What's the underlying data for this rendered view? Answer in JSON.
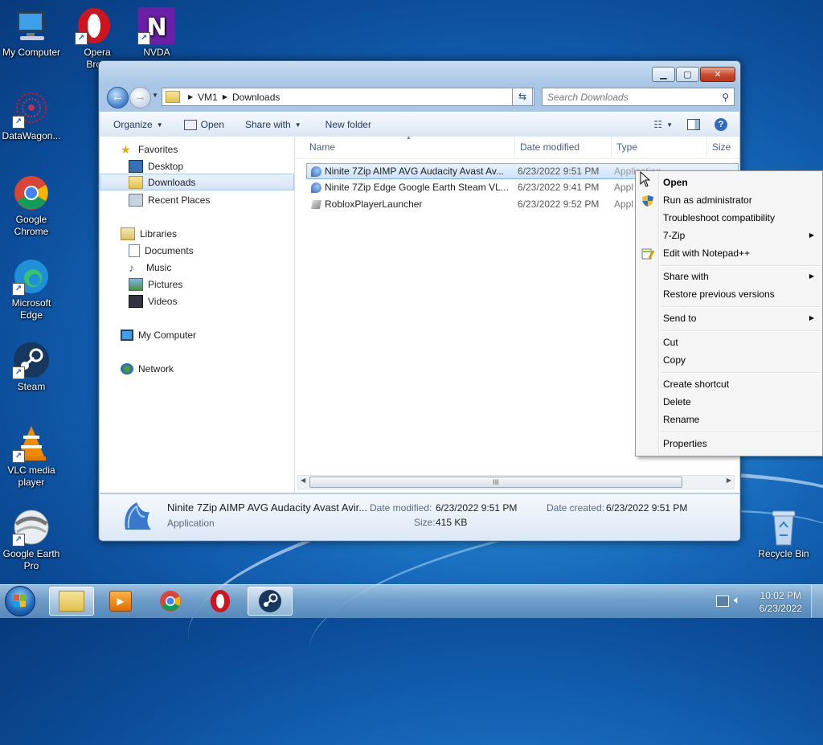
{
  "desktop": {
    "icons": [
      {
        "label": "My Computer"
      },
      {
        "label": "Opera Brow"
      },
      {
        "label": "NVDA"
      },
      {
        "label": "DataWagon..."
      },
      {
        "label": "Google Chrome"
      },
      {
        "label": "Microsoft Edge"
      },
      {
        "label": "Steam"
      },
      {
        "label": "VLC media player"
      },
      {
        "label": "Google Earth Pro"
      },
      {
        "label": "Recycle Bin"
      }
    ]
  },
  "explorer": {
    "breadcrumb": [
      "VM1",
      "Downloads"
    ],
    "search_placeholder": "Search Downloads",
    "toolbar": {
      "organize": "Organize",
      "open": "Open",
      "share_with": "Share with",
      "new_folder": "New folder"
    },
    "nav": {
      "favorites": "Favorites",
      "desktop": "Desktop",
      "downloads": "Downloads",
      "recent_places": "Recent Places",
      "libraries": "Libraries",
      "documents": "Documents",
      "music": "Music",
      "pictures": "Pictures",
      "videos": "Videos",
      "my_computer": "My Computer",
      "network": "Network"
    },
    "columns": {
      "name": "Name",
      "date_modified": "Date modified",
      "type": "Type",
      "size": "Size"
    },
    "files": [
      {
        "name": "Ninite 7Zip AIMP AVG Audacity Avast Av...",
        "date": "6/23/2022 9:51 PM",
        "type": "Application"
      },
      {
        "name": "Ninite 7Zip Edge Google Earth Steam VL...",
        "date": "6/23/2022 9:41 PM",
        "type": "Appl"
      },
      {
        "name": "RobloxPlayerLauncher",
        "date": "6/23/2022 9:52 PM",
        "type": "Appl"
      }
    ],
    "scroll_grip": "III",
    "details": {
      "name": "Ninite 7Zip AIMP AVG Audacity Avast Avir...",
      "type": "Application",
      "date_modified_label": "Date modified:",
      "date_modified": "6/23/2022 9:51 PM",
      "date_created_label": "Date created:",
      "date_created": "6/23/2022 9:51 PM",
      "size_label": "Size:",
      "size": "415 KB"
    }
  },
  "context_menu": {
    "open": "Open",
    "run_as_admin": "Run as administrator",
    "troubleshoot": "Troubleshoot compatibility",
    "seven_zip": "7-Zip",
    "edit_notepad": "Edit with Notepad++",
    "share_with": "Share with",
    "restore_versions": "Restore previous versions",
    "send_to": "Send to",
    "cut": "Cut",
    "copy": "Copy",
    "create_shortcut": "Create shortcut",
    "delete": "Delete",
    "rename": "Rename",
    "properties": "Properties"
  },
  "taskbar": {
    "time": "10:02 PM",
    "date": "6/23/2022"
  },
  "colors": {
    "accent": "#3c7fd3",
    "selection": "#cde2f8",
    "close_button": "#c94a2d"
  }
}
